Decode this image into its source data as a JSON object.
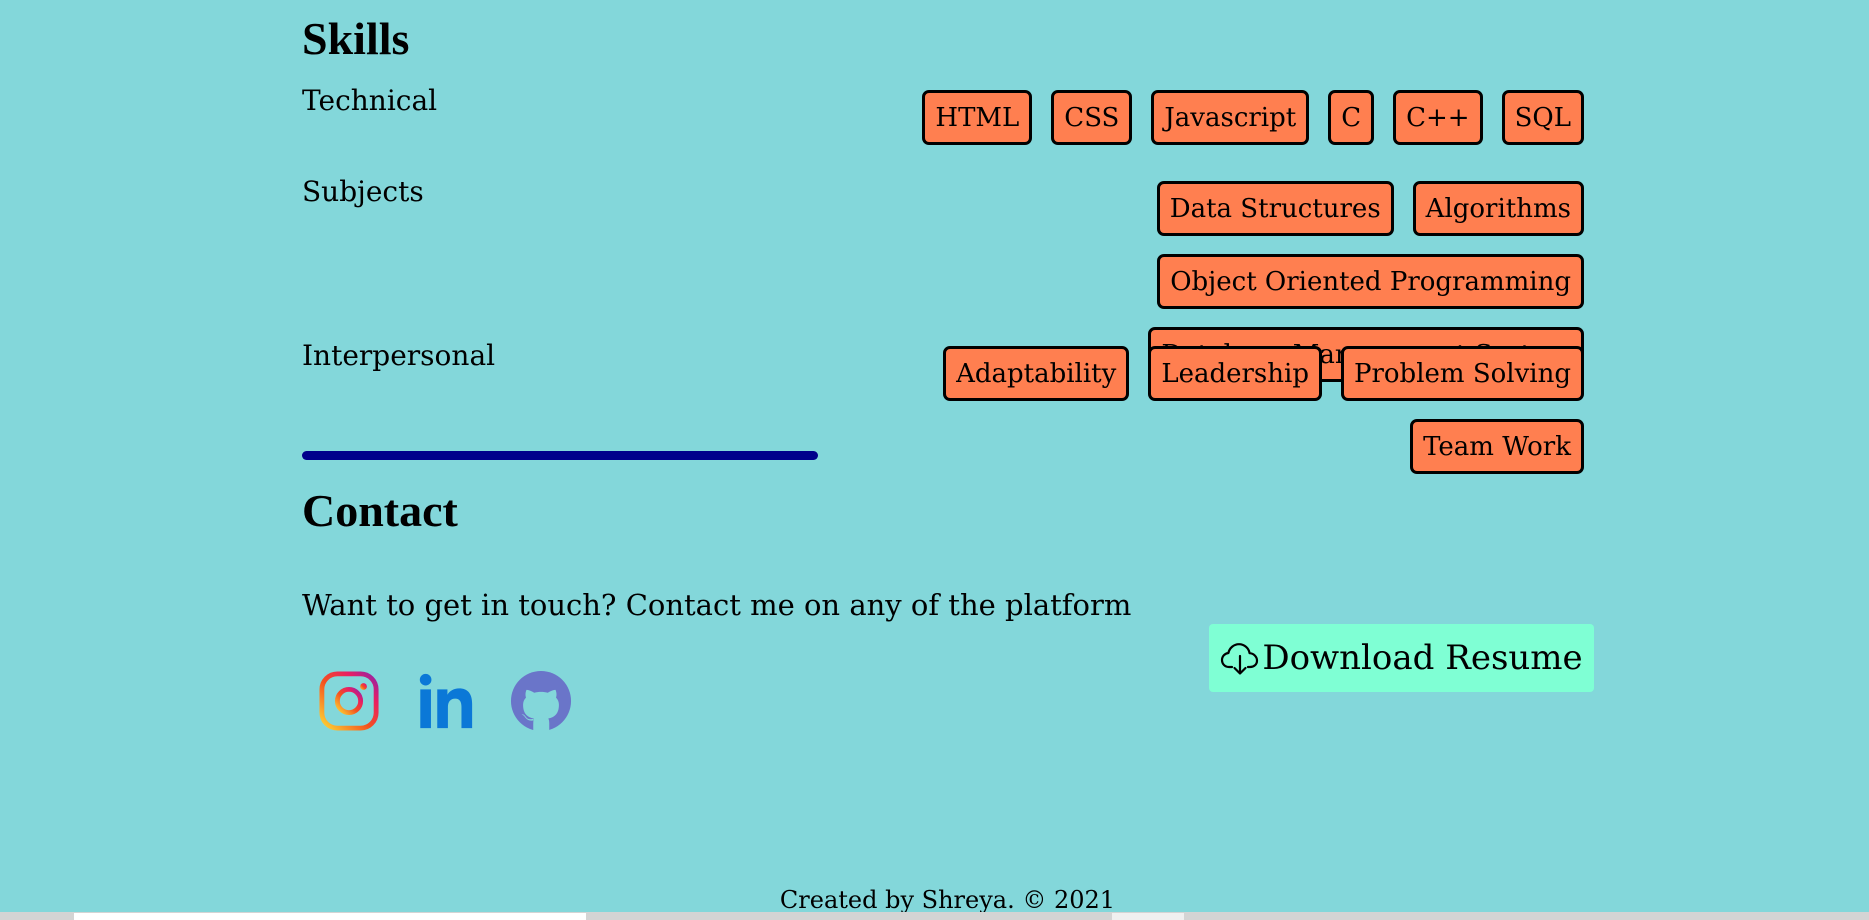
{
  "skills": {
    "title": "Skills",
    "technical": {
      "label": "Technical",
      "items": [
        "HTML",
        "CSS",
        "Javascript",
        "C",
        "C++",
        "SQL"
      ]
    },
    "subjects": {
      "label": "Subjects",
      "items": [
        "Data Structures",
        "Algorithms",
        "Object Oriented Programming",
        "Database Management System"
      ]
    },
    "interpersonal": {
      "label": "Interpersonal",
      "items": [
        "Adaptability",
        "Leadership",
        "Problem Solving",
        "Team Work"
      ]
    }
  },
  "contact": {
    "title": "Contact",
    "text": "Want to get in touch? Contact me on any of the platform",
    "social_icons": [
      "instagram-icon",
      "linkedin-icon",
      "github-icon"
    ],
    "download_label": "Download Resume",
    "download_icon": "cloud-download-icon"
  },
  "footer": {
    "text": "Created by Shreya. © 2021"
  },
  "colors": {
    "background": "#83d7da",
    "chip": "#ff7f50",
    "divider": "#00008b",
    "button": "#7fffd4"
  }
}
